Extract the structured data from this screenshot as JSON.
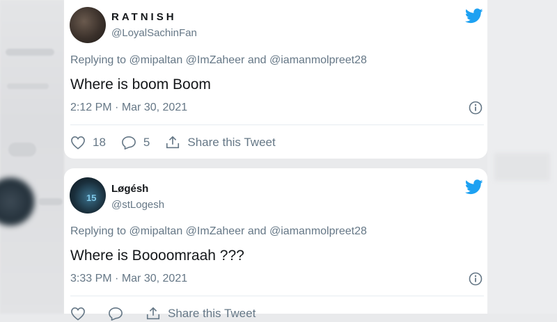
{
  "tweets": [
    {
      "display_name": "RATNISH",
      "handle": "@LoyalSachinFan",
      "replying_prefix": "Replying to",
      "mention1": "@mipaltan",
      "mention2": "@ImZaheer",
      "and_word": "and",
      "mention3": "@iamanmolpreet28",
      "text": "Where is boom Boom",
      "time": "2:12 PM",
      "separator": "·",
      "date": "Mar 30, 2021",
      "likes": "18",
      "replies": "5",
      "share_label": "Share this Tweet"
    },
    {
      "display_name": "Løgésh",
      "handle": "@stLogesh",
      "avatar_text": "15",
      "replying_prefix": "Replying to",
      "mention1": "@mipaltan",
      "mention2": "@ImZaheer",
      "and_word": "and",
      "mention3": "@iamanmolpreet28",
      "text": "Where is Boooomraah ???",
      "time": "3:33 PM",
      "separator": "·",
      "date": "Mar 30, 2021",
      "likes": "",
      "replies": "",
      "share_label": "Share this Tweet"
    }
  ],
  "colors": {
    "twitter_blue": "#1da1f2",
    "secondary_text": "#657786",
    "primary_text": "#14171a"
  },
  "icons": [
    "twitter-bird-icon",
    "info-icon",
    "heart-icon",
    "reply-icon",
    "share-icon"
  ]
}
